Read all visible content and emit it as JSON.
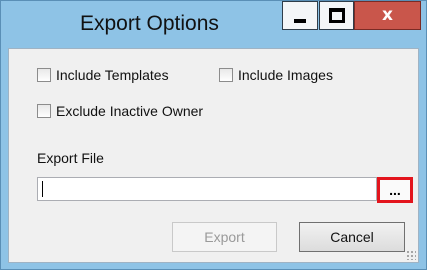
{
  "window": {
    "title": "Export Options",
    "controls": {
      "minimize_icon": "minimize-icon",
      "maximize_icon": "maximize-icon",
      "close_label": "x"
    }
  },
  "options": {
    "include_templates": {
      "label": "Include Templates",
      "checked": false
    },
    "include_images": {
      "label": "Include Images",
      "checked": false
    },
    "exclude_inactive_owner": {
      "label": "Exclude Inactive Owner",
      "checked": false
    }
  },
  "export_file": {
    "label": "Export File",
    "value": "",
    "browse_label": "...",
    "browse_highlight_color": "#e3151d"
  },
  "buttons": {
    "export_label": "Export",
    "export_enabled": false,
    "cancel_label": "Cancel"
  },
  "colors": {
    "titlebar": "#8ec3e6",
    "close_button": "#c9564b",
    "client_background": "#f0f0f0"
  }
}
